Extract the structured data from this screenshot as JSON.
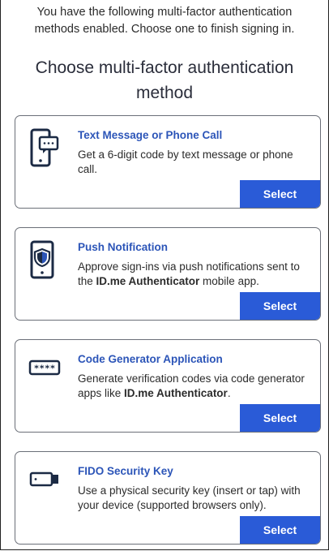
{
  "intro": "You have the following multi-factor authentication methods enabled. Choose one to finish signing in.",
  "heading": "Choose multi-factor authentication method",
  "methods": [
    {
      "icon": "phone-message-icon",
      "title": "Text Message or Phone Call",
      "desc_pre": "Get a 6-digit code by text message or phone call.",
      "desc_bold": "",
      "desc_post": "",
      "button": "Select"
    },
    {
      "icon": "phone-shield-icon",
      "title": "Push Notification",
      "desc_pre": "Approve sign-ins via push notifications sent to the ",
      "desc_bold": "ID.me Authenticator",
      "desc_post": " mobile app.",
      "button": "Select"
    },
    {
      "icon": "code-generator-icon",
      "title": "Code Generator Application",
      "desc_pre": "Generate verification codes via code generator apps like ",
      "desc_bold": "ID.me Authenticator",
      "desc_post": ".",
      "button": "Select"
    },
    {
      "icon": "security-key-icon",
      "title": "FIDO Security Key",
      "desc_pre": "Use a physical security key (insert or tap) with your device (supported browsers only).",
      "desc_bold": "",
      "desc_post": "",
      "button": "Select"
    }
  ],
  "code_icon_text": "****",
  "colors": {
    "accent": "#2a5bd7",
    "title": "#2c55b8",
    "icon": "#1b2a44"
  }
}
